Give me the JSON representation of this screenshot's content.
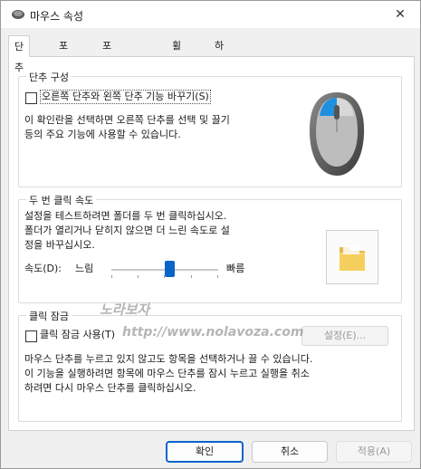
{
  "window": {
    "title": "마우스 속성",
    "close_glyph": "✕"
  },
  "tabs": [
    {
      "label": "단추",
      "active": true
    },
    {
      "label": "포인터",
      "active": false
    },
    {
      "label": "포인터 옵션",
      "active": false
    },
    {
      "label": "휠",
      "active": false
    },
    {
      "label": "하드웨어",
      "active": false
    }
  ],
  "button_config": {
    "group_title": "단추 구성",
    "checkbox_label": "오른쪽 단추와 왼쪽 단추 기능 바꾸기(S)",
    "checked": false,
    "description_line1": "이 확인란을 선택하면 오른쪽 단추를 선택 및 끌기",
    "description_line2": "등의 주요 기능에 사용할 수 있습니다."
  },
  "double_click": {
    "group_title": "두 번 클릭 속도",
    "description_line1": "설정을 테스트하려면 폴더를 두 번 클릭하십시오.",
    "description_line2": "폴더가 열리거나 닫히지 않으면 더 느린 속도로 설",
    "description_line3": "정을 바꾸십시오.",
    "speed_label": "속도(D):",
    "slow_label": "느림",
    "fast_label": "빠름",
    "speed_fraction": 0.55
  },
  "click_lock": {
    "group_title": "클릭 잠금",
    "checkbox_label": "클릭 잠금 사용(T)",
    "checked": false,
    "settings_label": "설정(E)...",
    "description_line1": "마우스 단추를 누르고 있지 않고도 항목을 선택하거나 끌 수 있습니다.",
    "description_line2": "이 기능을 실행하려면 항목에 마우스 단추를 잠시 누르고 실행을 취소",
    "description_line3": "하려면 다시 마우스 단추를 클릭하십시오."
  },
  "footer": {
    "ok_label": "확인",
    "cancel_label": "취소",
    "apply_label": "적용(A)"
  },
  "watermark": {
    "line1": "노라보자",
    "line2": "http://www.nolavoza.com"
  },
  "colors": {
    "accent": "#0a64c8",
    "mouse_blue": "#1e90e0"
  },
  "icons": {
    "title": "mouse-icon",
    "close": "close-icon",
    "mouse_preview": "mouse-illustration",
    "folder": "folder-icon"
  }
}
